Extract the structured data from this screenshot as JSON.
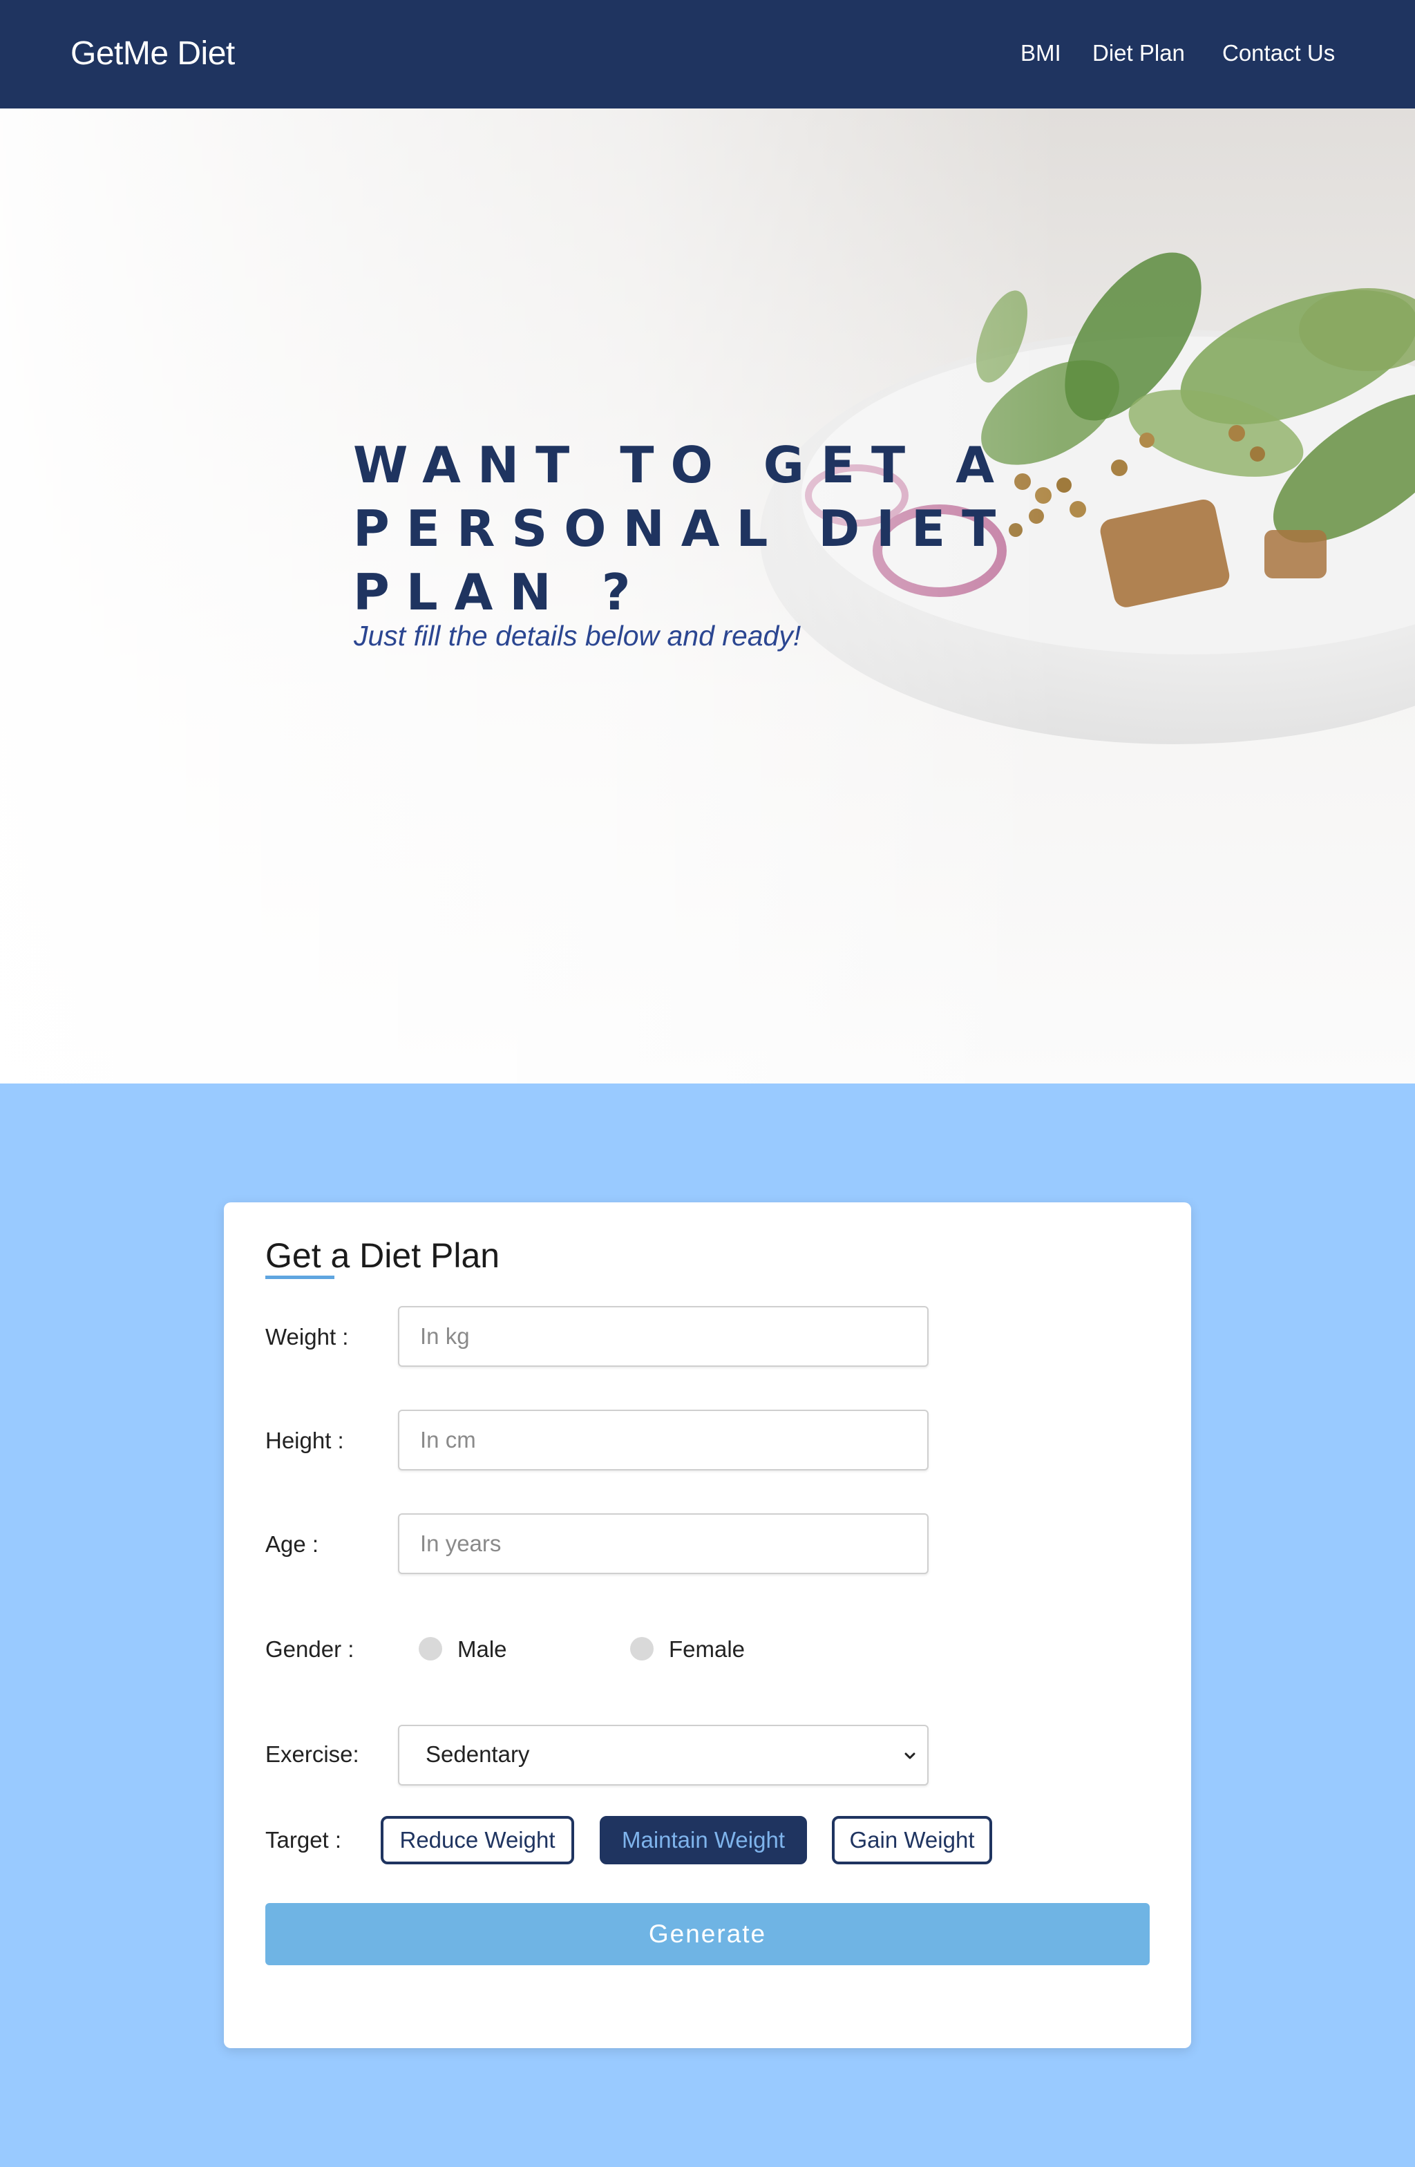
{
  "navbar": {
    "brand": "GetMe Diet",
    "links": [
      "BMI",
      "Diet Plan",
      "Contact Us"
    ]
  },
  "hero": {
    "title": "WANT TO GET A PERSONAL DIET PLAN ?",
    "subtitle": "Just fill the details below and ready!",
    "background_image": "salad bowl photo"
  },
  "form": {
    "title": "Get a Diet Plan",
    "weight": {
      "label": "Weight :",
      "placeholder": "In kg"
    },
    "height": {
      "label": "Height :",
      "placeholder": "In cm"
    },
    "age": {
      "label": "Age :",
      "placeholder": "In years"
    },
    "gender": {
      "label": "Gender :",
      "options": [
        "Male",
        "Female"
      ]
    },
    "exercise": {
      "label": "Exercise:",
      "selected": "Sedentary"
    },
    "target": {
      "label": "Target :",
      "options": [
        "Reduce Weight",
        "Maintain Weight",
        "Gain Weight"
      ],
      "selected": "Maintain Weight"
    },
    "submit_label": "Generate"
  },
  "colors": {
    "navy": "#1f3460",
    "page_background": "#99caff",
    "generate_button": "#6fb4e4",
    "accent_text": "#2b4691"
  }
}
